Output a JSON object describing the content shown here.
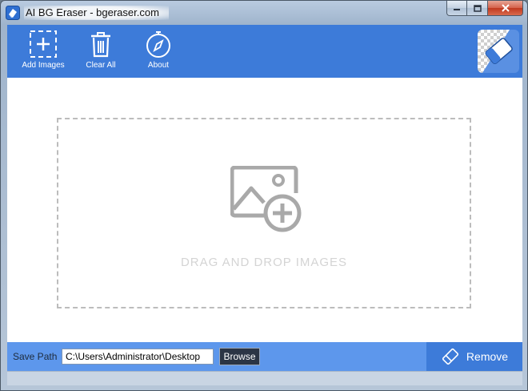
{
  "window": {
    "title": "AI BG Eraser - bgeraser.com",
    "controls": {
      "minimize": "minimize",
      "maximize": "maximize",
      "close": "close"
    }
  },
  "toolbar": {
    "add_images": {
      "label": "Add Images",
      "icon": "add-image-icon"
    },
    "clear_all": {
      "label": "Clear All",
      "icon": "trash-icon"
    },
    "about": {
      "label": "About",
      "icon": "compass-icon"
    },
    "brand_icon": "eraser-logo-icon"
  },
  "dropzone": {
    "text": "DRAG AND DROP IMAGES",
    "icon": "image-add-icon"
  },
  "bottom": {
    "save_path_label": "Save Path",
    "save_path_value": "C:\\Users\\Administrator\\Desktop",
    "browse_label": "Browse",
    "remove_label": "Remove",
    "remove_icon": "eraser-icon"
  },
  "colors": {
    "toolbar": "#3d7bd9",
    "bottombar": "#5d97ec",
    "remove_button": "#3d7bd9",
    "browse_button": "#2b3545",
    "dropzone_border": "#bcbcbc"
  }
}
